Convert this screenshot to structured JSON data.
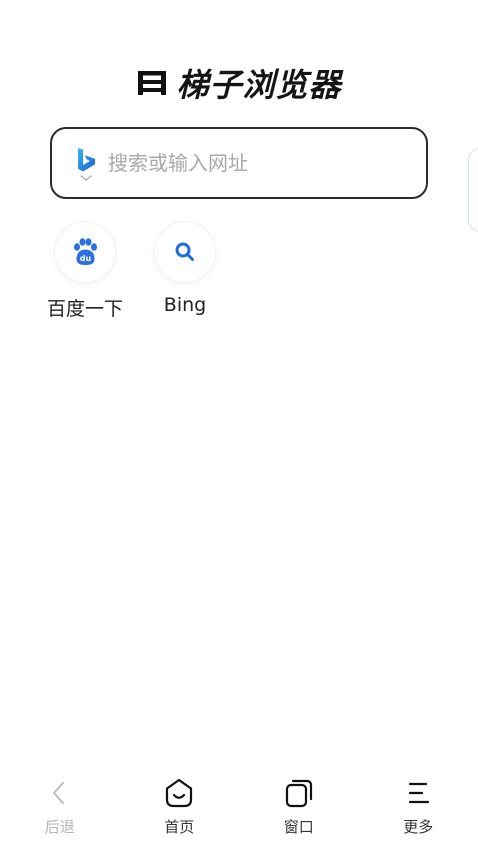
{
  "app": {
    "title": "梯子浏览器"
  },
  "search": {
    "placeholder": "搜索或输入网址",
    "engine_icon": "bing-icon"
  },
  "shortcuts": [
    {
      "label": "百度一下",
      "icon": "baidu-paw-icon"
    },
    {
      "label": "Bing",
      "icon": "search-icon"
    }
  ],
  "nav": {
    "back": {
      "label": "后退",
      "icon": "chevron-left-icon"
    },
    "home": {
      "label": "首页",
      "icon": "home-smile-icon"
    },
    "windows": {
      "label": "窗口",
      "icon": "windows-icon"
    },
    "more": {
      "label": "更多",
      "icon": "menu-icon"
    }
  },
  "colors": {
    "bing_blue": "#1a73e8",
    "search_icon_blue": "#1e6fd9",
    "baidu_blue": "#2b6fe0",
    "disabled": "#b5b5b5",
    "border": "#2b2b2b"
  }
}
